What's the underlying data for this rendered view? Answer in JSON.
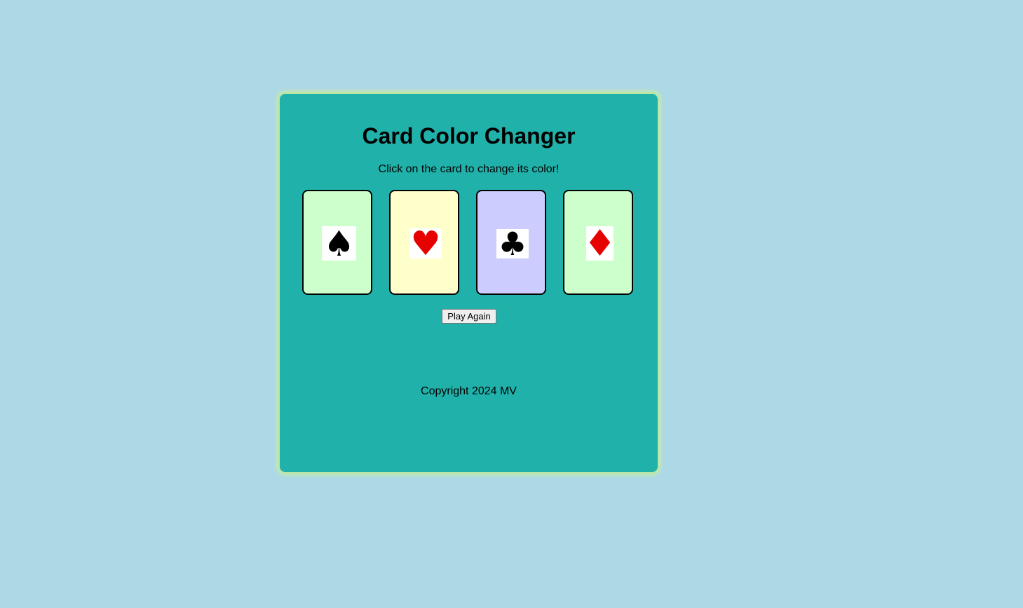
{
  "game": {
    "title": "Card Color Changer",
    "instructions": "Click on the card to change its color!",
    "cards": [
      {
        "suit": "spade",
        "symbol": "♠",
        "symbol_color": "#000000",
        "background": "#ccffcc"
      },
      {
        "suit": "heart",
        "symbol": "♥",
        "symbol_color": "#e60000",
        "background": "#ffffcc"
      },
      {
        "suit": "club",
        "symbol": "♣",
        "symbol_color": "#000000",
        "background": "#ccccff"
      },
      {
        "suit": "diamond",
        "symbol": "♦",
        "symbol_color": "#e60000",
        "background": "#ccffcc"
      }
    ],
    "play_again_label": "Play Again",
    "copyright": "Copyright 2024 MV"
  },
  "colors": {
    "page_background": "#add8e6",
    "panel_background": "#20b2aa",
    "panel_border": "#b7e6a8"
  }
}
